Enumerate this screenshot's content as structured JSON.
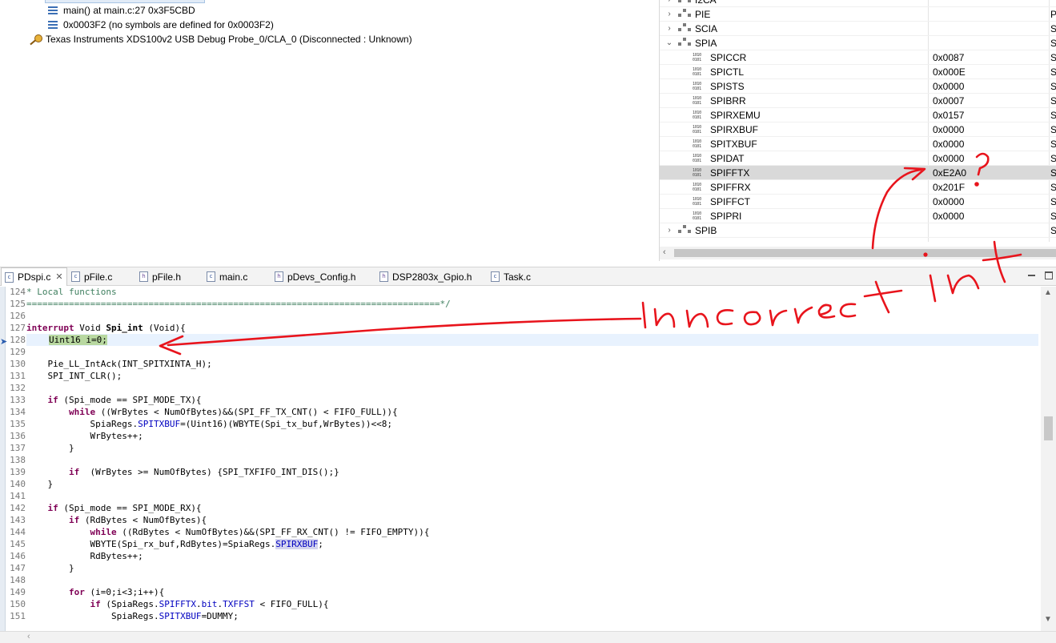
{
  "debug": {
    "items": [
      {
        "text": "main() at main.c:27 0x3F5CBD"
      },
      {
        "text": "0x0003F2  (no symbols are defined for 0x0003F2)"
      },
      {
        "text": "Texas Instruments XDS100v2 USB Debug Probe_0/CLA_0 (Disconnected : Unknown)"
      }
    ]
  },
  "registers": {
    "groups_top": [
      {
        "name": "I2CA"
      },
      {
        "name": "PIE",
        "desc": "P"
      },
      {
        "name": "SCIA",
        "desc": "S"
      },
      {
        "name": "SPIA",
        "desc": "S"
      }
    ],
    "rows": [
      {
        "name": "SPICCR",
        "value": "0x0087",
        "desc": "S"
      },
      {
        "name": "SPICTL",
        "value": "0x000E",
        "desc": "S"
      },
      {
        "name": "SPISTS",
        "value": "0x0000",
        "desc": "S"
      },
      {
        "name": "SPIBRR",
        "value": "0x0007",
        "desc": "S"
      },
      {
        "name": "SPIRXEMU",
        "value": "0x0157",
        "desc": "S"
      },
      {
        "name": "SPIRXBUF",
        "value": "0x0000",
        "desc": "S"
      },
      {
        "name": "SPITXBUF",
        "value": "0x0000",
        "desc": "S"
      },
      {
        "name": "SPIDAT",
        "value": "0x0000",
        "desc": "S"
      },
      {
        "name": "SPIFFTX",
        "value": "0xE2A0",
        "desc": "S"
      },
      {
        "name": "SPIFFRX",
        "value": "0x201F",
        "desc": "S"
      },
      {
        "name": "SPIFFCT",
        "value": "0x0000",
        "desc": "S"
      },
      {
        "name": "SPIPRI",
        "value": "0x0000",
        "desc": "S"
      }
    ],
    "group_bottom": {
      "name": "SPIB",
      "desc": "S"
    }
  },
  "tabs": [
    {
      "label": "PDspi.c",
      "type": "c"
    },
    {
      "label": "pFile.c",
      "type": "c"
    },
    {
      "label": "pFile.h",
      "type": "h"
    },
    {
      "label": "main.c",
      "type": "c"
    },
    {
      "label": "pDevs_Config.h",
      "type": "h"
    },
    {
      "label": "DSP2803x_Gpio.h",
      "type": "h"
    },
    {
      "label": "Task.c",
      "type": "c"
    }
  ],
  "code": {
    "ln": [
      "124",
      "125",
      "126",
      "127",
      "128",
      "129",
      "130",
      "131",
      "132",
      "133",
      "134",
      "135",
      "136",
      "137",
      "138",
      "139",
      "140",
      "141",
      "142",
      "143",
      "144",
      "145",
      "146",
      "147",
      "148",
      "149",
      "150",
      "151"
    ],
    "l124": "* Local functions",
    "l125": "==============================================================================*/",
    "l127_kw1": "interrupt",
    "l127_rest": " Void ",
    "l127_fn": "Spi_int",
    "l127_tail": " (Void){",
    "l128": "Uint16 i=0;",
    "l130": "    Pie_LL_IntAck(INT_SPITXINTA_H);",
    "l131": "    SPI_INT_CLR();",
    "l133_kw": "if",
    "l133_rest": " (Spi_mode == SPI_MODE_TX){",
    "l134_kw": "while",
    "l134_rest": " ((WrBytes < NumOfBytes)&&(SPI_FF_TX_CNT() < FIFO_FULL)){",
    "l135_a": "SpiaRegs.",
    "l135_f": "SPITXBUF",
    "l135_b": "=(Uint16)(WBYTE(Spi_tx_buf,WrBytes))<<8;",
    "l136": "WrBytes++;",
    "l137": "}",
    "l139_kw": "if",
    "l139_rest": "  (WrBytes >= NumOfBytes) {SPI_TXFIFO_INT_DIS();}",
    "l140": "}",
    "l142_kw": "if",
    "l142_rest": " (Spi_mode == SPI_MODE_RX){",
    "l143_kw": "if",
    "l143_rest": " (RdBytes < NumOfBytes){",
    "l144_kw": "while",
    "l144_rest": " ((RdBytes < NumOfBytes)&&(SPI_FF_RX_CNT() != FIFO_EMPTY)){",
    "l145_a": "WBYTE(Spi_rx_buf,RdBytes)=SpiaRegs.",
    "l145_f": "SPIRXBUF",
    "l145_b": ";",
    "l146": "RdBytes++;",
    "l147": "}",
    "l149_kw": "for",
    "l149_rest": " (i=0;i<3;i++){",
    "l150_kw": "if",
    "l150_a": " (SpiaRegs.",
    "l150_f1": "SPIFFTX",
    "l150_dot": ".",
    "l150_bit": "bit",
    "l150_dot2": ".",
    "l150_f2": "TXFFST",
    "l150_b": " < FIFO_FULL){",
    "l151_a": "SpiaRegs.",
    "l151_f": "SPITXBUF",
    "l151_b": "=DUMMY;"
  },
  "colors": {
    "annotation": "#e8141c",
    "keyword": "#7f0055",
    "comment": "#3f7f5f",
    "field": "#0000c0"
  }
}
